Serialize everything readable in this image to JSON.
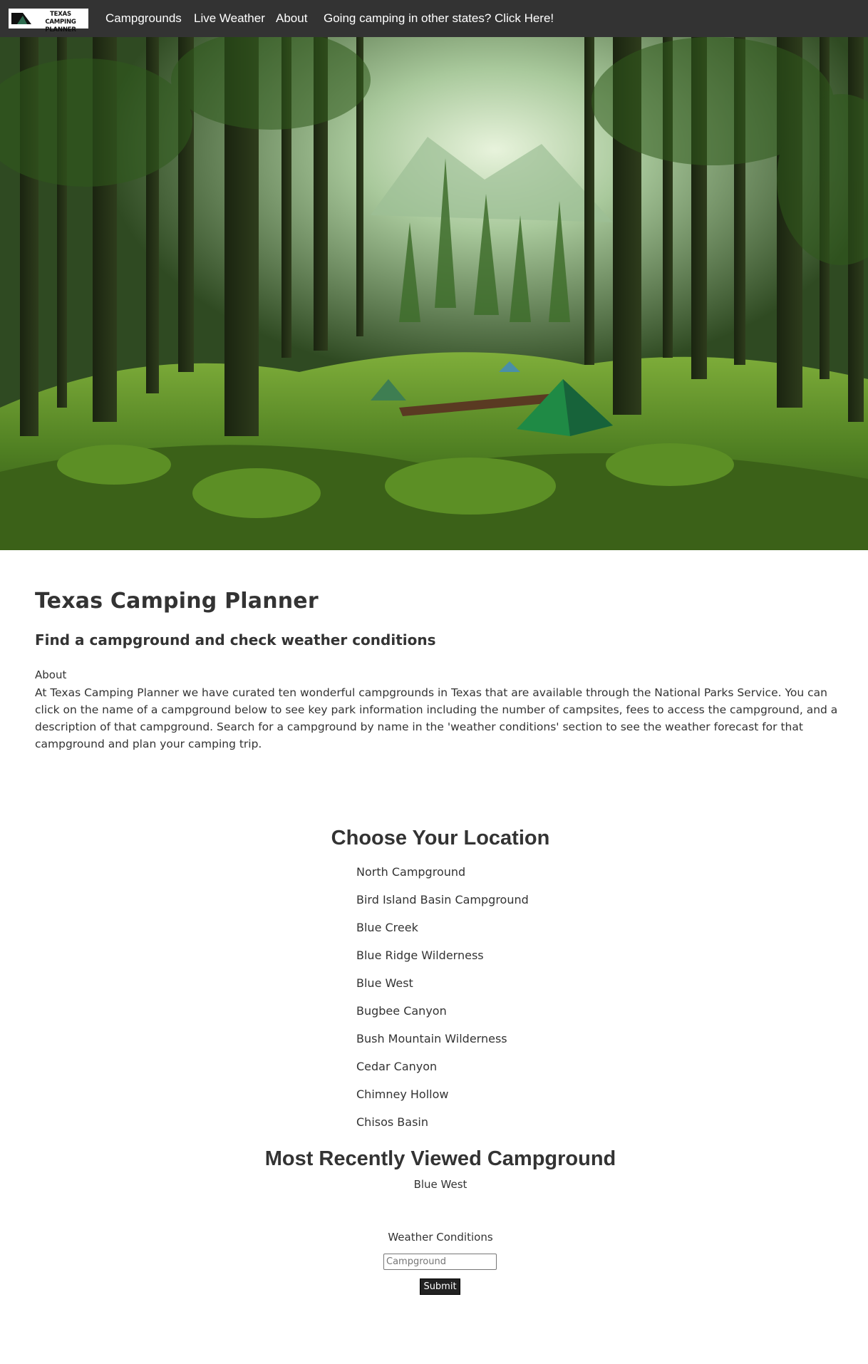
{
  "nav": {
    "logo_text_line1": "TEXAS CAMPING",
    "logo_text_line2": "PLANNER",
    "links": [
      "Campgrounds",
      "Live Weather",
      "About",
      "Going camping in other states? Click Here!"
    ]
  },
  "intro": {
    "title": "Texas Camping Planner",
    "tagline": "Find a campground and check weather conditions",
    "about_heading": "About",
    "about_text": "At Texas Camping Planner we have curated ten wonderful campgrounds in Texas that are available through the National Parks Service. You can click on the name of a campground below to see key park information including the number of campsites, fees to access the campground, and a description of that campground. Search for a campground by name in the 'weather conditions' section to see the weather forecast for that campground and plan your camping trip."
  },
  "locations": {
    "heading": "Choose Your Location",
    "items": [
      "North Campground",
      "Bird Island Basin Campground",
      "Blue Creek",
      "Blue Ridge Wilderness",
      "Blue West",
      "Bugbee Canyon",
      "Bush Mountain Wilderness",
      "Cedar Canyon",
      "Chimney Hollow",
      "Chisos Basin"
    ]
  },
  "recent": {
    "heading": "Most Recently Viewed Campground",
    "value": "Blue West"
  },
  "weather": {
    "label": "Weather Conditions",
    "placeholder": "Campground",
    "submit_label": "Submit"
  },
  "colors": {
    "navbar_bg": "#333333",
    "text": "#333333",
    "button_bg": "#222222"
  }
}
